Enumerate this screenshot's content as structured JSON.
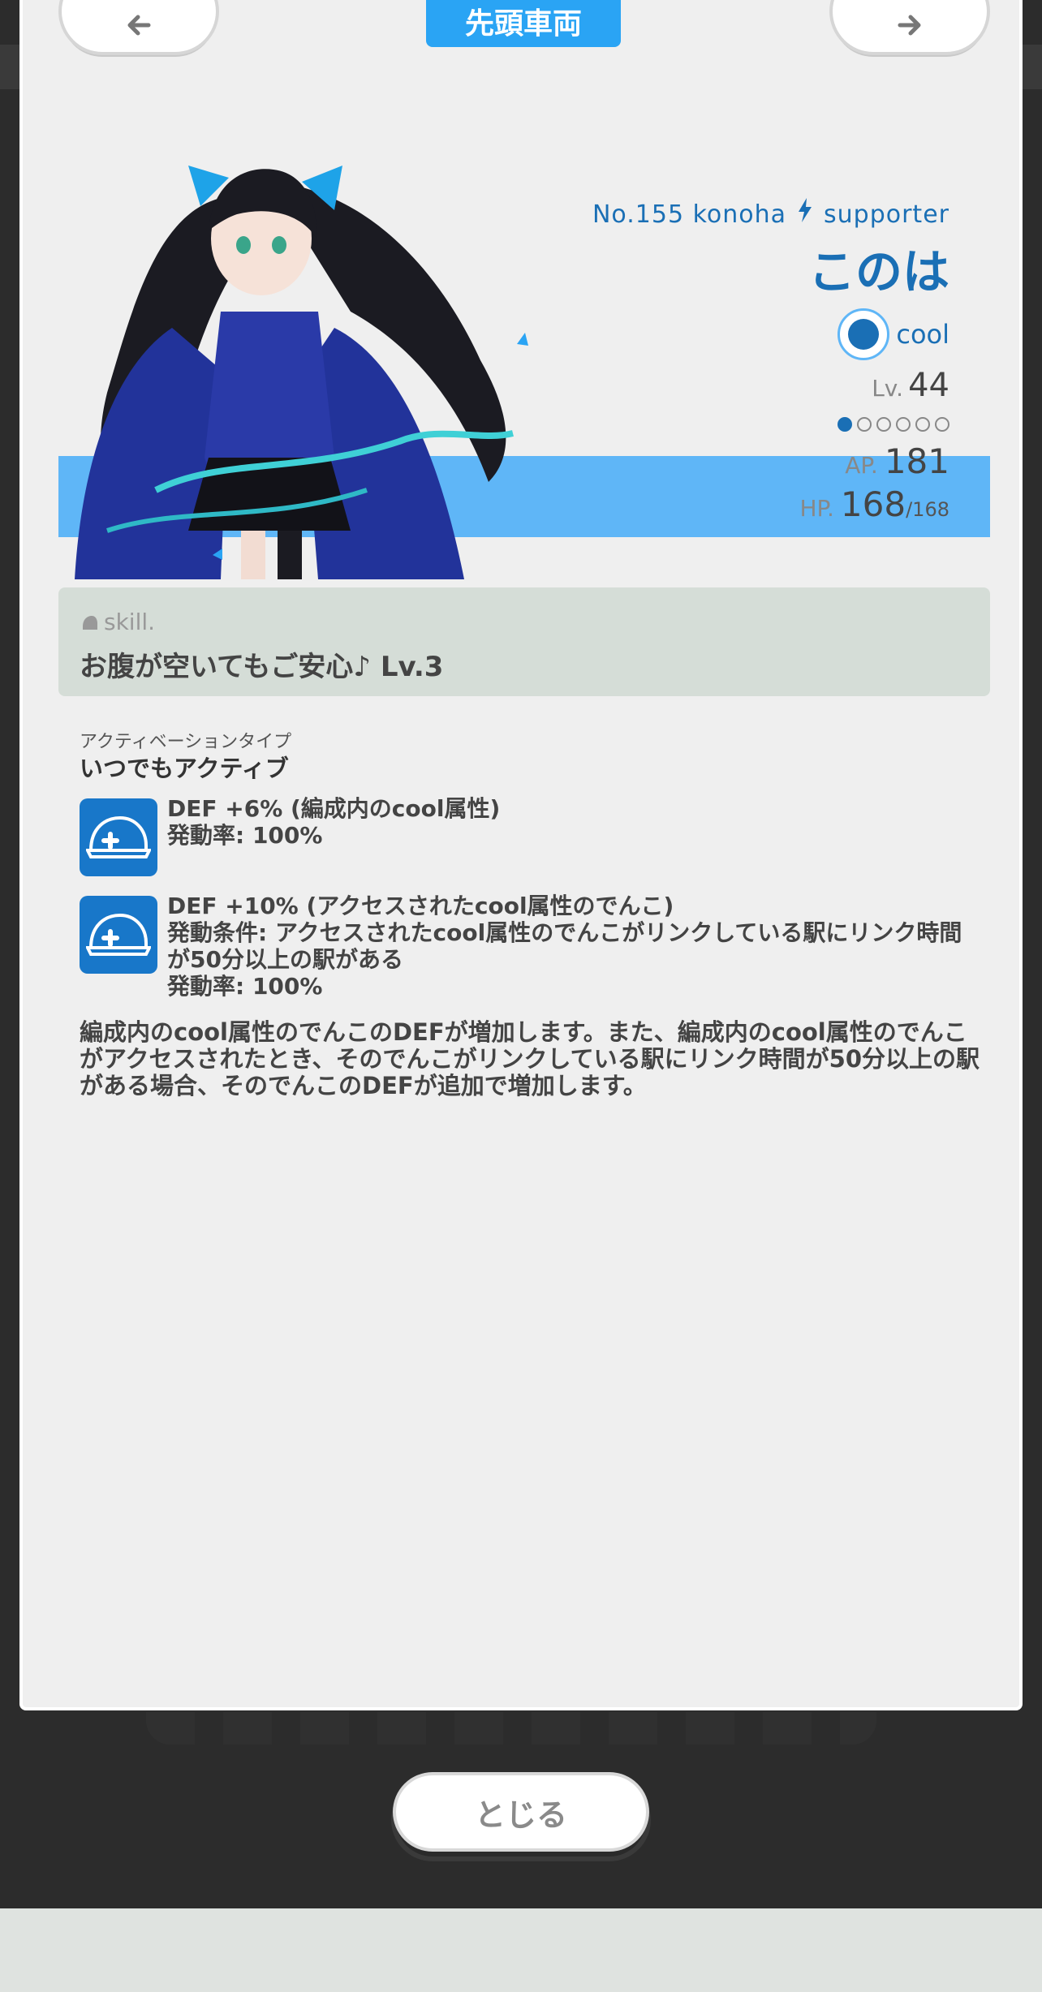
{
  "header": {
    "title": "先頭車両"
  },
  "character": {
    "id_line": "No.155 konoha",
    "role": "supporter",
    "name": "このは",
    "attribute": "cool",
    "level_label": "Lv.",
    "level": "44",
    "rank_total": 6,
    "rank_filled": 1,
    "ap_label": "AP.",
    "ap": "181",
    "hp_label": "HP.",
    "hp": "168",
    "hp_max": "/168"
  },
  "skill": {
    "label": "skill.",
    "name": "お腹が空いてもご安心♪ Lv.3",
    "activation_caption": "アクティベーションタイプ",
    "activation_type": "いつでもアクティブ",
    "effects": [
      {
        "icon": "helmet-plus-icon",
        "line1": "DEF +6% (編成内のcool属性)",
        "line2": "発動率: 100%"
      },
      {
        "icon": "helmet-plus-icon",
        "line1": "DEF +10% (アクセスされたcool属性のでんこ)",
        "line2": "発動条件: アクセスされたcool属性のでんこがリンクしている駅にリンク時間が50分以上の駅がある",
        "line3": "発動率: 100%"
      }
    ],
    "description": "編成内のcool属性のでんこのDEFが増加します。また、編成内のcool属性のでんこがアクセスされたとき、そのでんこがリンクしている駅にリンク時間が50分以上の駅がある場合、そのでんこのDEFが追加で増加します。"
  },
  "footer": {
    "close_label": "とじる"
  },
  "colors": {
    "accent": "#2aa4f4",
    "name": "#1a6fb5",
    "band": "#5fb6f7",
    "skill_bg": "#d5ddd7"
  }
}
